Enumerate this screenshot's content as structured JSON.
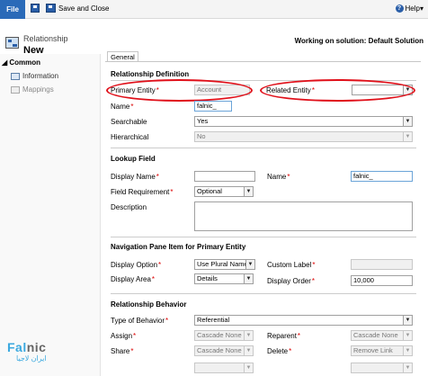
{
  "ribbon": {
    "file_label": "File",
    "save_close_label": "Save and Close",
    "help_label": "Help",
    "help_caret": "▾"
  },
  "header": {
    "entity_type": "Relationship",
    "entity_name": "New",
    "solution": "Working on solution: Default Solution"
  },
  "sidebar": {
    "section": "Common",
    "items": [
      {
        "label": "Information"
      },
      {
        "label": "Mappings"
      }
    ]
  },
  "tabs": [
    {
      "label": "General"
    }
  ],
  "relationship_definition": {
    "title": "Relationship Definition",
    "primary_entity_label": "Primary Entity",
    "primary_entity_value": "Account",
    "related_entity_label": "Related Entity",
    "related_entity_value": "",
    "name_label": "Name",
    "name_value": "falnic_",
    "searchable_label": "Searchable",
    "searchable_value": "Yes",
    "hierarchical_label": "Hierarchical",
    "hierarchical_value": "No"
  },
  "lookup_field": {
    "title": "Lookup Field",
    "display_name_label": "Display Name",
    "display_name_value": "",
    "name_label": "Name",
    "name_value": "falnic_",
    "field_requirement_label": "Field Requirement",
    "field_requirement_value": "Optional",
    "description_label": "Description"
  },
  "navigation_pane": {
    "title": "Navigation Pane Item for Primary Entity",
    "display_option_label": "Display Option",
    "display_option_value": "Use Plural Name",
    "custom_label_label": "Custom Label",
    "custom_label_value": "",
    "display_area_label": "Display Area",
    "display_area_value": "Details",
    "display_order_label": "Display Order",
    "display_order_value": "10,000"
  },
  "relationship_behavior": {
    "title": "Relationship Behavior",
    "type_label": "Type of Behavior",
    "type_value": "Referential",
    "assign_label": "Assign",
    "assign_value": "Cascade None",
    "reparent_label": "Reparent",
    "reparent_value": "Cascade None",
    "share_label": "Share",
    "share_value": "Cascade None",
    "delete_label": "Delete",
    "delete_value": "Remove Link"
  },
  "watermark": {
    "brand_blue": "Fal",
    "brand_gray": "nic",
    "brand_sub": "ایران لاجیا"
  },
  "colors": {
    "file_button": "#2a6ab8",
    "highlight": "#e0101a",
    "required": "#d00000"
  }
}
